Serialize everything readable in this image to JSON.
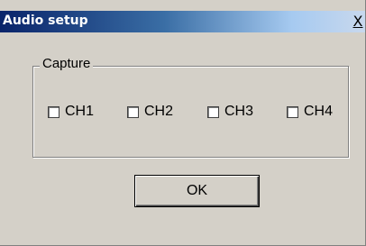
{
  "window": {
    "title": "Audio setup",
    "close_label": "X"
  },
  "capture": {
    "group_label": "Capture",
    "channels": [
      {
        "label": "CH1",
        "checked": false
      },
      {
        "label": "CH2",
        "checked": false
      },
      {
        "label": "CH3",
        "checked": false
      },
      {
        "label": "CH4",
        "checked": false
      }
    ]
  },
  "buttons": {
    "ok_label": "OK"
  },
  "colors": {
    "face": "#d4d0c8",
    "title_start": "#0a246a",
    "title_end": "#a6caf0"
  }
}
